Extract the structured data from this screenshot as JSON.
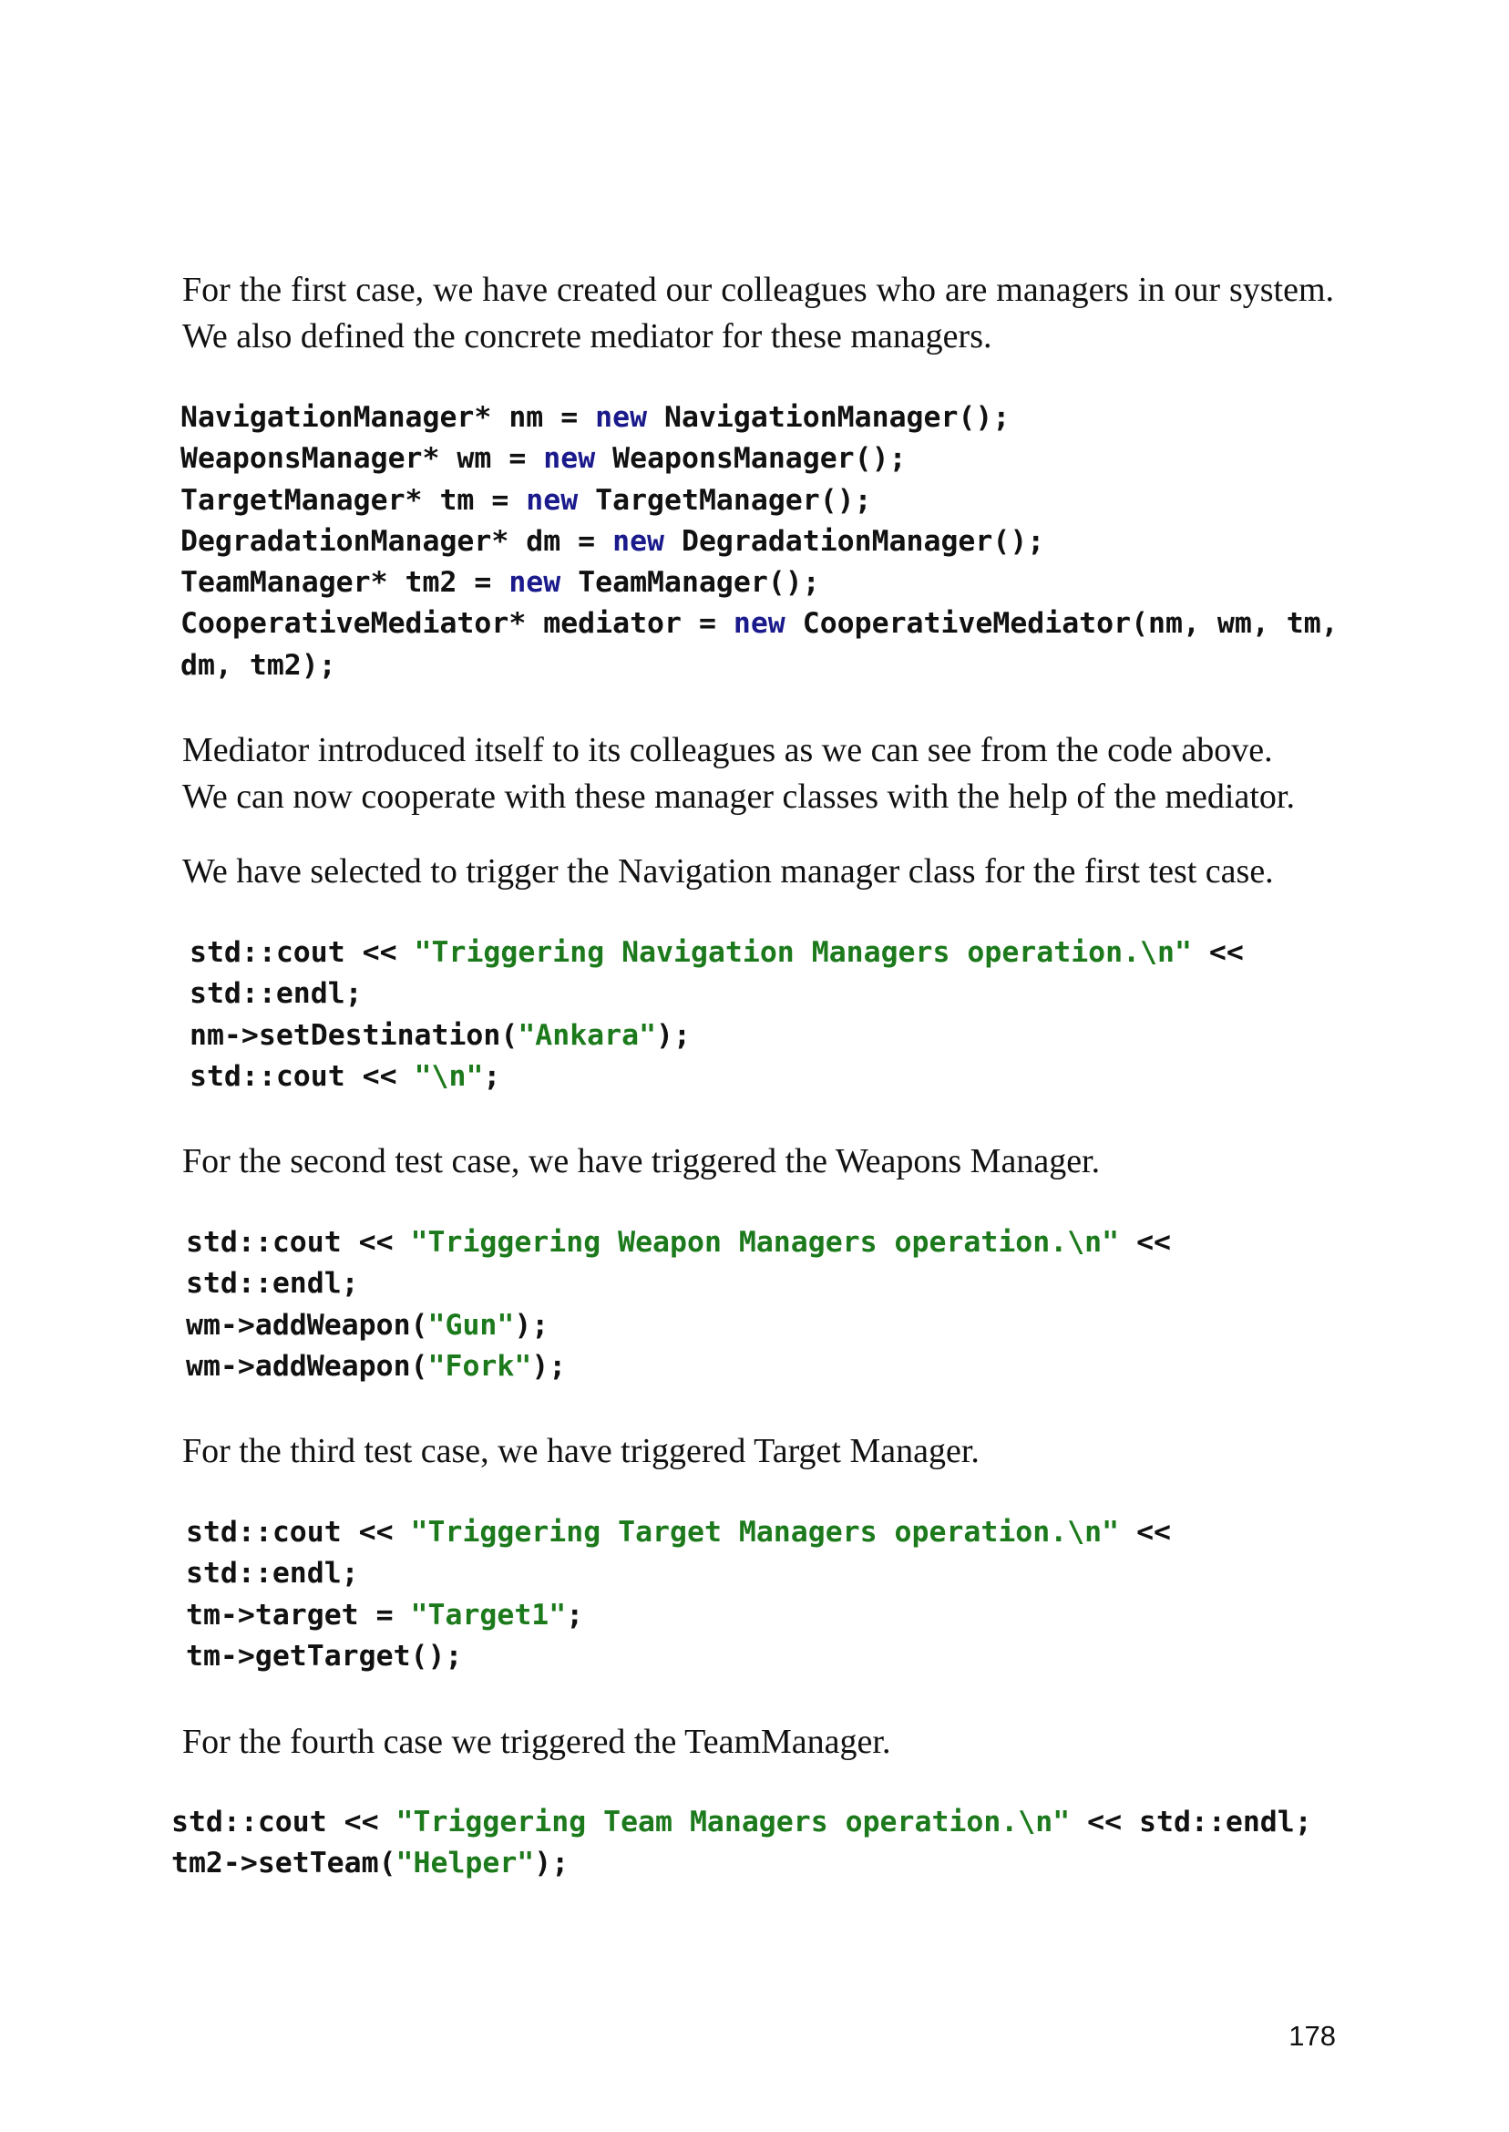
{
  "paragraphs": {
    "p1": "For the first case, we have created our colleagues who are managers in our system. We also defined the concrete mediator for these managers.",
    "p2_line1": "Mediator introduced itself to its colleagues as we can see from the code above.",
    "p2_line2": "We can now cooperate with these manager classes with the help of the mediator.",
    "p3": "We have selected to trigger the Navigation manager class for the first test case.",
    "p4": "For the second test case, we have triggered the Weapons Manager.",
    "p5": "For the third test case, we have triggered Target Manager.",
    "p6": "For the fourth case we triggered the TeamManager."
  },
  "code1": {
    "l1": {
      "a": "NavigationManager* nm = ",
      "kw": "new",
      "b": " NavigationManager();"
    },
    "l2": {
      "a": "WeaponsManager* wm = ",
      "kw": "new",
      "b": " WeaponsManager();"
    },
    "l3": {
      "a": "TargetManager* tm = ",
      "kw": "new",
      "b": " TargetManager();"
    },
    "l4": {
      "a": "DegradationManager* dm = ",
      "kw": "new",
      "b": " DegradationManager();"
    },
    "l5": {
      "a": "TeamManager* tm2 = ",
      "kw": "new",
      "b": " TeamManager();"
    },
    "l6": {
      "a": "CooperativeMediator* mediator = ",
      "kw": "new",
      "b": " CooperativeMediator(nm, wm, tm,"
    },
    "l7": {
      "a": "dm, tm2);"
    }
  },
  "code2": {
    "l1": {
      "a": "std::cout << ",
      "s": "\"Triggering Navigation Managers operation.\\n\"",
      "b": " <<"
    },
    "l2": {
      "a": "std::endl;"
    },
    "l3": {
      "a": "nm->setDestination(",
      "s": "\"Ankara\"",
      "b": ");"
    },
    "l4": {
      "a": "std::cout << ",
      "s": "\"\\n\"",
      "b": ";"
    }
  },
  "code3": {
    "l1": {
      "a": "std::cout << ",
      "s": "\"Triggering Weapon Managers operation.\\n\"",
      "b": " <<"
    },
    "l2": {
      "a": "std::endl;"
    },
    "l3": {
      "a": "wm->addWeapon(",
      "s": "\"Gun\"",
      "b": ");"
    },
    "l4": {
      "a": "wm->addWeapon(",
      "s": "\"Fork\"",
      "b": ");"
    }
  },
  "code4": {
    "l1": {
      "a": "std::cout << ",
      "s": "\"Triggering Target Managers operation.\\n\"",
      "b": " <<"
    },
    "l2": {
      "a": "std::endl;"
    },
    "l3": {
      "a": "tm->target = ",
      "s": "\"Target1\"",
      "b": ";"
    },
    "l4": {
      "a": "tm->getTarget();"
    }
  },
  "code5": {
    "l1": {
      "a": "std::cout << ",
      "s": "\"Triggering Team Managers operation.\\n\"",
      "b": " << std::endl;"
    },
    "l2": {
      "a": "tm2->setTeam(",
      "s": "\"Helper\"",
      "b": ");"
    }
  },
  "page_number": "178",
  "colors": {
    "keyword": "#1a1a8c",
    "string": "#1c7a1c",
    "text": "#111111"
  }
}
